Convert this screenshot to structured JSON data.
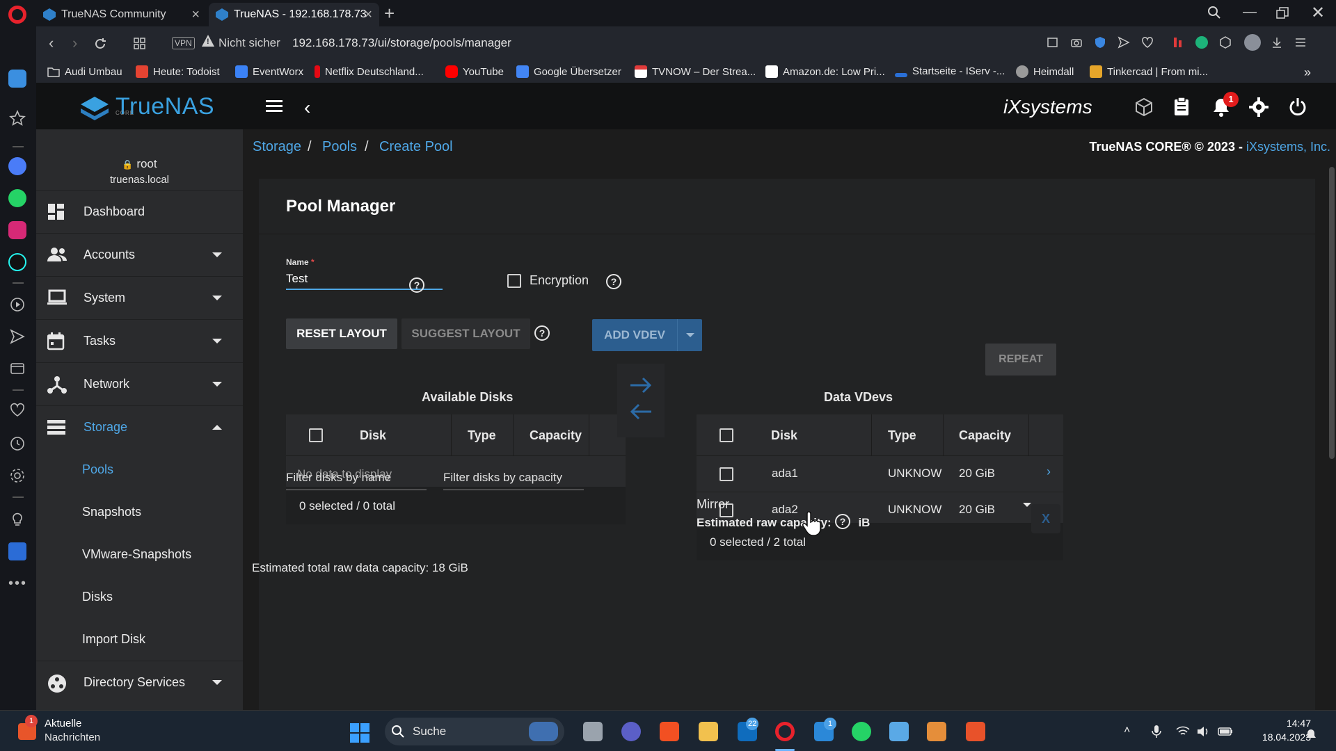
{
  "browser": {
    "tabs": [
      {
        "label": "TrueNAS Community"
      },
      {
        "label": "TrueNAS - 192.168.178.73"
      }
    ],
    "vpn": "VPN",
    "security": "Nicht sicher",
    "url": "192.168.178.73/ui/storage/pools/manager",
    "bookmarks": [
      {
        "label": "Audi Umbau",
        "color": "#cfcfcf"
      },
      {
        "label": "Heute: Todoist",
        "color": "#e44332"
      },
      {
        "label": "EventWorx",
        "color": "#3b82f6"
      },
      {
        "label": "Netflix Deutschland...",
        "color": "#e50914"
      },
      {
        "label": "YouTube",
        "color": "#ff0000"
      },
      {
        "label": "Google Übersetzer",
        "color": "#4285f4"
      },
      {
        "label": "TVNOW – Der Strea...",
        "color": "#ffffff"
      },
      {
        "label": "Amazon.de: Low Pri...",
        "color": "#ffffff"
      },
      {
        "label": "Startseite - IServ -...",
        "color": "#2a6fd6"
      },
      {
        "label": "Heimdall",
        "color": "#9a9a9a"
      },
      {
        "label": "Tinkercad | From mi...",
        "color": "#e5a52a"
      }
    ]
  },
  "app": {
    "logo": "TrueNAS",
    "logo_sub": "CORE",
    "vendor": "iXsystems",
    "notification_count": "1",
    "user": {
      "name": "root",
      "host": "truenas.local"
    },
    "nav": [
      {
        "label": "Dashboard",
        "icon": "dashboard-icon"
      },
      {
        "label": "Accounts",
        "icon": "accounts-icon"
      },
      {
        "label": "System",
        "icon": "system-icon"
      },
      {
        "label": "Tasks",
        "icon": "tasks-icon"
      },
      {
        "label": "Network",
        "icon": "network-icon"
      },
      {
        "label": "Storage",
        "icon": "storage-icon"
      },
      {
        "label": "Directory Services",
        "icon": "directory-services-icon"
      }
    ],
    "storage_sub": [
      "Pools",
      "Snapshots",
      "VMware-Snapshots",
      "Disks",
      "Import Disk"
    ],
    "breadcrumb": [
      "Storage",
      "Pools",
      "Create Pool"
    ],
    "copyright": "TrueNAS CORE® © 2023 -",
    "copyright_link": "iXsystems, Inc."
  },
  "pool": {
    "title": "Pool Manager",
    "name_label": "Name",
    "name_required": "*",
    "name_value": "Test",
    "encryption_label": "Encryption",
    "buttons": {
      "reset": "RESET LAYOUT",
      "suggest": "SUGGEST LAYOUT",
      "add_vdev": "ADD VDEV",
      "repeat": "REPEAT"
    },
    "available": {
      "title": "Available Disks",
      "columns": [
        "Disk",
        "Type",
        "Capacity"
      ],
      "empty": "No data to display",
      "footer": "0 selected / 0 total",
      "filter_name": "Filter disks by name",
      "filter_capacity": "Filter disks by capacity"
    },
    "vdevs": {
      "title": "Data VDevs",
      "columns": [
        "Disk",
        "Type",
        "Capacity"
      ],
      "rows": [
        {
          "disk": "ada1",
          "type": "UNKNOW",
          "capacity": "20 GiB"
        },
        {
          "disk": "ada2",
          "type": "UNKNOW",
          "capacity": "20 GiB"
        }
      ],
      "footer": "0 selected / 2 total",
      "layout": "Mirror",
      "est_raw_label": "Estimated raw capacity:",
      "est_raw_value": "iB",
      "remove": "X"
    },
    "estimated_total": "Estimated total raw data capacity: 18 GiB"
  },
  "taskbar": {
    "news_line1": "Aktuelle",
    "news_line2": "Nachrichten",
    "news_badge": "1",
    "search": "Suche",
    "mail_badge": "22",
    "outlook_badge": "1",
    "time": "14:47",
    "date": "18.04.2023"
  }
}
